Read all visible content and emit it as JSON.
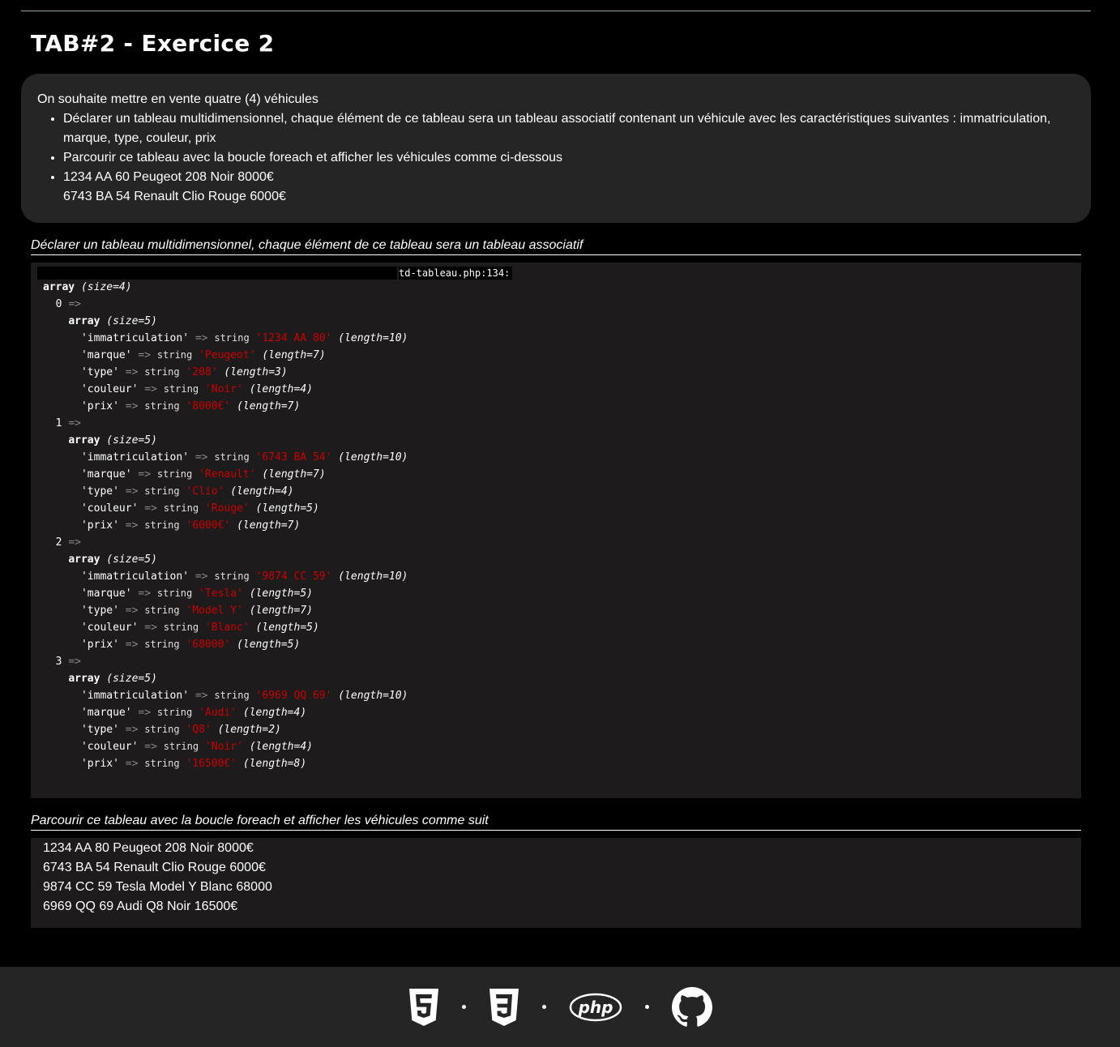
{
  "page": {
    "title": "TAB#2 - Exercice 2"
  },
  "intro": {
    "lead": "On souhaite mettre en vente quatre (4) véhicules",
    "items": [
      "Déclarer un tableau multidimensionnel, chaque élément de ce tableau sera un tableau associatif contenant un véhicule avec les caractéristiques suivantes : immatriculation, marque, type, couleur, prix",
      "Parcourir ce tableau avec la boucle foreach et afficher les véhicules comme ci-dessous"
    ],
    "example_lines": [
      "1234 AA 60 Peugeot 208 Noir 8000€",
      "6743 BA 54 Renault Clio Rouge 6000€"
    ]
  },
  "section1": {
    "title": "Déclarer un tableau multidimensionnel, chaque élément de ce tableau sera un tableau associatif"
  },
  "dump": {
    "file": "td-tableau.php:134:",
    "root_label": "array",
    "root_size": "(size=4)",
    "entries": [
      {
        "index": "0",
        "size": "(size=5)",
        "fields": [
          {
            "key": "'immatriculation'",
            "value": "'1234 AA 80'",
            "length": "(length=10)"
          },
          {
            "key": "'marque'",
            "value": "'Peugeot'",
            "length": "(length=7)"
          },
          {
            "key": "'type'",
            "value": "'208'",
            "length": "(length=3)"
          },
          {
            "key": "'couleur'",
            "value": "'Noir'",
            "length": "(length=4)"
          },
          {
            "key": "'prix'",
            "value": "'8000€'",
            "length": "(length=7)"
          }
        ]
      },
      {
        "index": "1",
        "size": "(size=5)",
        "fields": [
          {
            "key": "'immatriculation'",
            "value": "'6743 BA 54'",
            "length": "(length=10)"
          },
          {
            "key": "'marque'",
            "value": "'Renault'",
            "length": "(length=7)"
          },
          {
            "key": "'type'",
            "value": "'Clio'",
            "length": "(length=4)"
          },
          {
            "key": "'couleur'",
            "value": "'Rouge'",
            "length": "(length=5)"
          },
          {
            "key": "'prix'",
            "value": "'6000€'",
            "length": "(length=7)"
          }
        ]
      },
      {
        "index": "2",
        "size": "(size=5)",
        "fields": [
          {
            "key": "'immatriculation'",
            "value": "'9874 CC 59'",
            "length": "(length=10)"
          },
          {
            "key": "'marque'",
            "value": "'Tesla'",
            "length": "(length=5)"
          },
          {
            "key": "'type'",
            "value": "'Model Y'",
            "length": "(length=7)"
          },
          {
            "key": "'couleur'",
            "value": "'Blanc'",
            "length": "(length=5)"
          },
          {
            "key": "'prix'",
            "value": "'68000'",
            "length": "(length=5)"
          }
        ]
      },
      {
        "index": "3",
        "size": "(size=5)",
        "fields": [
          {
            "key": "'immatriculation'",
            "value": "'6969 QQ 69'",
            "length": "(length=10)"
          },
          {
            "key": "'marque'",
            "value": "'Audi'",
            "length": "(length=4)"
          },
          {
            "key": "'type'",
            "value": "'Q8'",
            "length": "(length=2)"
          },
          {
            "key": "'couleur'",
            "value": "'Noir'",
            "length": "(length=4)"
          },
          {
            "key": "'prix'",
            "value": "'16500€'",
            "length": "(length=8)"
          }
        ]
      }
    ]
  },
  "section2": {
    "title": "Parcourir ce tableau avec la boucle foreach et afficher les véhicules comme suit",
    "lines": [
      "1234 AA 80 Peugeot 208 Noir 8000€",
      "6743 BA 54 Renault Clio Rouge 6000€",
      "9874 CC 59 Tesla Model Y Blanc 68000",
      "6969 QQ 69 Audi Q8 Noir 16500€"
    ]
  },
  "footer": {
    "icons": [
      "html5-icon",
      "css3-icon",
      "php-icon",
      "github-icon"
    ],
    "php_label": "php"
  },
  "colors": {
    "background": "#000000",
    "panel": "#252525",
    "dump_bg": "#1d1b1b",
    "string_value": "#cc0000"
  }
}
